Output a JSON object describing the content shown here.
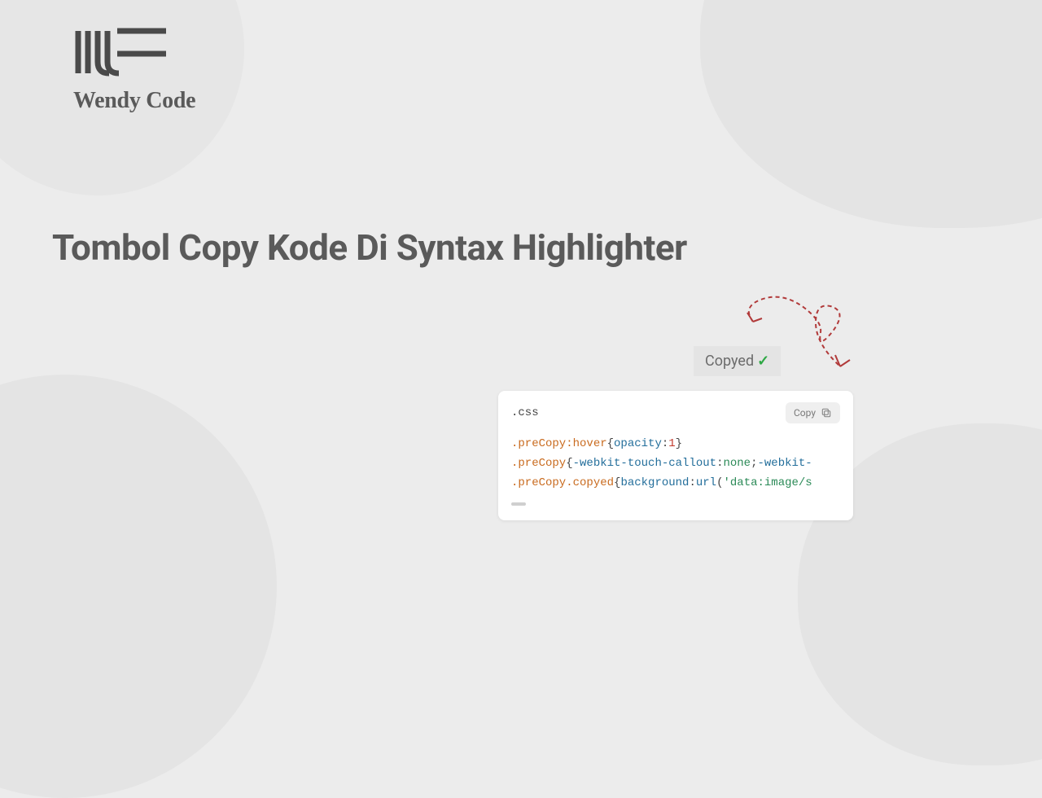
{
  "brand": {
    "name": "Wendy Code"
  },
  "headline": "Tombol Copy Kode Di Syntax Highlighter",
  "copied_badge": {
    "label": "Copyed",
    "check": "✓"
  },
  "code": {
    "lang": ".css",
    "copy_label": "Copy",
    "line1": {
      "sel": ".preCopy:hover",
      "brace_open": "{",
      "prop": "opacity",
      "colon": ":",
      "num": "1",
      "brace_close": "}"
    },
    "line2": {
      "sel": ".preCopy",
      "brace_open": "{",
      "prop1": "-webkit-touch-callout",
      "colon1": ":",
      "val1": "none",
      "semi": ";",
      "prop2": "-webkit-"
    },
    "line3": {
      "sel": ".preCopy.copyed",
      "brace_open": "{",
      "prop": "background",
      "colon": ":",
      "fn": "url",
      "paren": "(",
      "str": "'data:image/s"
    }
  }
}
